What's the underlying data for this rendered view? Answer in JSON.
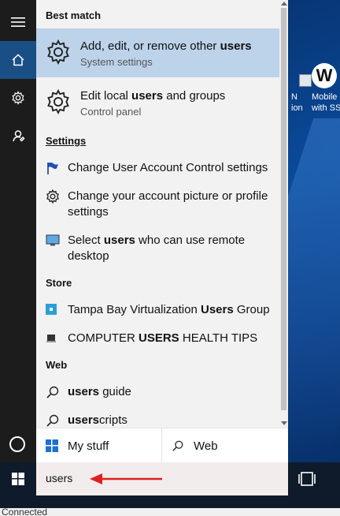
{
  "desktop": {
    "icons": [
      {
        "label_line1": "N",
        "label_line2": "ion",
        "icon": "shortcut-icon"
      },
      {
        "label_line1": "Mobile",
        "label_line2": "with SS",
        "glyph": "W",
        "icon": "webex-app-icon"
      }
    ]
  },
  "rail": {
    "items": [
      {
        "name": "hamburger-menu-icon"
      },
      {
        "name": "home-icon",
        "active": true
      },
      {
        "name": "settings-gear-icon"
      },
      {
        "name": "feedback-icon"
      }
    ],
    "cortana_icon": "cortana-circle-icon"
  },
  "results": {
    "best_match_heading": "Best match",
    "best_match": {
      "title_pre": "Add, edit, or remove other ",
      "title_bold": "users",
      "subtitle": "System settings",
      "icon": "gear-icon"
    },
    "second": {
      "title_pre": "Edit local ",
      "title_bold": "users",
      "title_post": " and groups",
      "subtitle": "Control panel",
      "icon": "gear-icon"
    },
    "settings_heading": "Settings",
    "settings": [
      {
        "text": "Change User Account Control settings",
        "icon": "flag-icon"
      },
      {
        "text": "Change your account picture or profile settings",
        "icon": "gear-icon"
      },
      {
        "pre": "Select ",
        "bold": "users",
        "post": " who can use remote desktop",
        "icon": "monitor-icon"
      }
    ],
    "store_heading": "Store",
    "store": [
      {
        "pre": "Tampa Bay Virtualization ",
        "bold": "Users",
        "post": " Group",
        "icon": "app-tile-icon"
      },
      {
        "pre": "COMPUTER ",
        "bold": "USERS",
        "post": " HEALTH TIPS",
        "icon": "book-icon"
      }
    ],
    "web_heading": "Web",
    "web": [
      {
        "bold": "users",
        "post": " guide",
        "icon": "search-icon"
      },
      {
        "bold": "users",
        "post": "cripts",
        "icon": "search-icon"
      }
    ]
  },
  "tabs": {
    "my_stuff": "My stuff",
    "web": "Web"
  },
  "search": {
    "query": "users"
  },
  "colors": {
    "highlight": "#bcd3ea",
    "rail": "#1c1c1c",
    "rail_active": "#1a4f86",
    "arrow": "#e02020"
  },
  "status_bar": {
    "text": "Connected"
  }
}
